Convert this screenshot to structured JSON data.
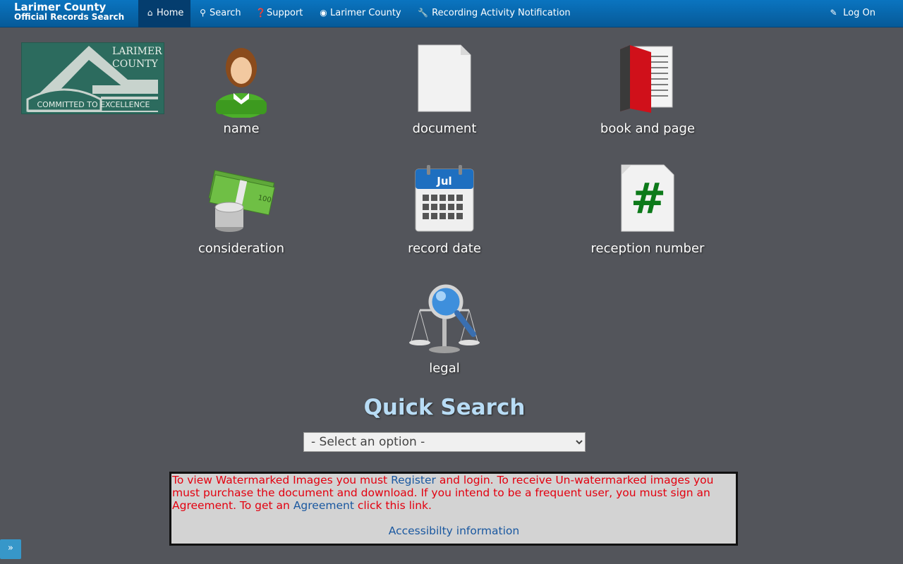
{
  "brand": {
    "line1": "Larimer County",
    "line2": "Official Records Search"
  },
  "nav": {
    "home": "Home",
    "search": "Search",
    "support": "Support",
    "county": "Larimer County",
    "recording": "Recording Activity Notification",
    "logon": "Log On"
  },
  "logo": {
    "line1": "LARIMER",
    "line2": "COUNTY",
    "tagline": "COMMITTED TO EXCELLENCE"
  },
  "tiles": {
    "name": "name",
    "document": "document",
    "book_page": "book and page",
    "consideration": "consideration",
    "record_date": "record date",
    "reception_number": "reception number",
    "legal": "legal"
  },
  "calendar_month": "Jul",
  "quick_search": {
    "title": "Quick Search",
    "selected_option": "- Select an option -"
  },
  "notice": {
    "part1": "To view Watermarked Images you must ",
    "register": "Register",
    "part2": " and login. To receive Un-watermarked images you must purchase the document and download. If you intend to be a frequent user, you must sign an Agreement. To get an ",
    "agreement": "Agreement",
    "part3": " click this link.",
    "accessibility": "Accessibilty information"
  },
  "sidebar_toggle": "»",
  "colors": {
    "nav": "#0a74c0",
    "nav_active": "#043d6e",
    "background": "#53555b",
    "notice_text": "#e3000f",
    "link": "#1a58a0",
    "qs_title": "#b8dcf5"
  }
}
